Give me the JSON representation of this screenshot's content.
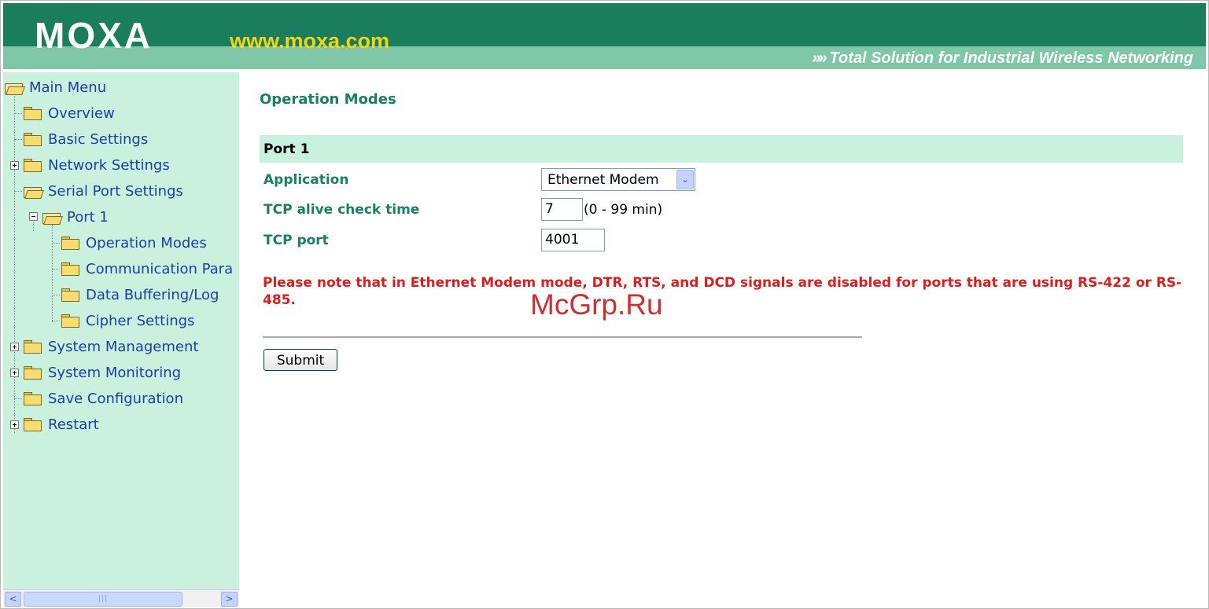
{
  "header": {
    "logo_text": "MOXA",
    "site_url": "www.moxa.com",
    "tagline_arrows": "»»",
    "tagline": "Total Solution for Industrial Wireless Networking",
    "colors": {
      "dark_green": "#1a7d5c",
      "light_green": "#7fc7a6",
      "url_yellow": "#f2d41a"
    }
  },
  "sidebar": {
    "items": [
      {
        "label": "Main Menu",
        "icon": "folder-open-icon"
      },
      {
        "label": "Overview",
        "icon": "folder-icon"
      },
      {
        "label": "Basic Settings",
        "icon": "folder-icon"
      },
      {
        "label": "Network Settings",
        "icon": "folder-icon",
        "expander": "collapsed"
      },
      {
        "label": "Serial Port Settings",
        "icon": "folder-open-icon"
      },
      {
        "label": "Port 1",
        "icon": "folder-open-icon",
        "expander": "expanded"
      },
      {
        "label": "Operation Modes",
        "icon": "folder-icon"
      },
      {
        "label": "Communication Para",
        "icon": "folder-icon"
      },
      {
        "label": "Data Buffering/Log",
        "icon": "folder-icon"
      },
      {
        "label": "Cipher Settings",
        "icon": "folder-icon"
      },
      {
        "label": "System Management",
        "icon": "folder-icon",
        "expander": "collapsed"
      },
      {
        "label": "System Monitoring",
        "icon": "folder-icon",
        "expander": "collapsed"
      },
      {
        "label": "Save Configuration",
        "icon": "folder-icon"
      },
      {
        "label": "Restart",
        "icon": "folder-icon",
        "expander": "collapsed"
      }
    ],
    "colors": {
      "background": "#c9f1dd",
      "text": "#1d3ea3"
    },
    "scrollbar": {
      "left_arrow": "<",
      "right_arrow": ">",
      "thumb_grip": "|||"
    }
  },
  "main": {
    "title": "Operation Modes",
    "port_title": "Port 1",
    "application": {
      "label": "Application",
      "value": "Ethernet Modem",
      "dropdown_arrow": "⌄"
    },
    "alive_check": {
      "label": "TCP alive check time",
      "value": "7",
      "unit": "(0 - 99 min)"
    },
    "tcp_port": {
      "label": "TCP port",
      "value": "4001"
    },
    "note": "Please note that in Ethernet Modem mode, DTR, RTS, and DCD signals are disabled for ports that are using RS-422 or RS-485.",
    "submit_label": "Submit",
    "colors": {
      "label_green": "#1b7e61",
      "note_red": "#d81e1e"
    }
  },
  "watermark": "McGrp.Ru"
}
